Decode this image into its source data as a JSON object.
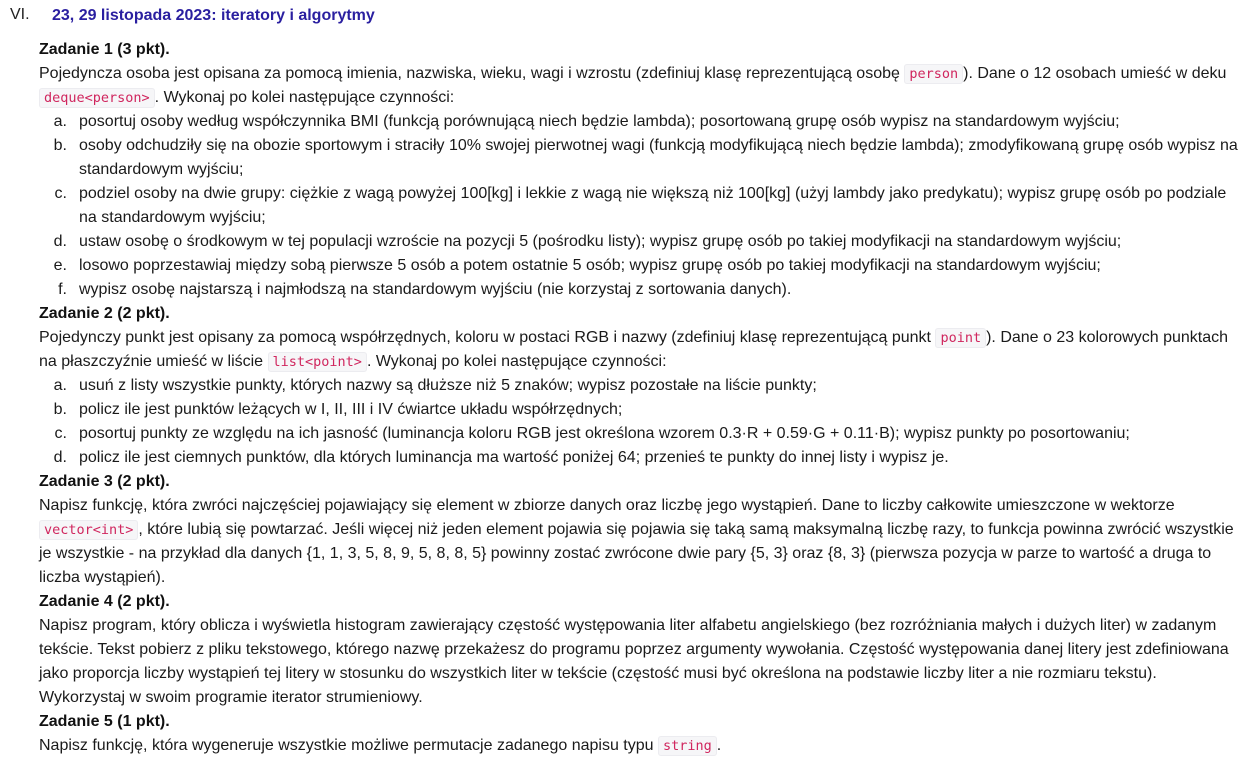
{
  "section": {
    "number": "VI.",
    "title": "23, 29 listopada 2023: iteratory i algorytmy"
  },
  "tasks": [
    {
      "title": "Zadanie 1 (3 pkt).",
      "intro": [
        "Pojedyncza osoba jest opisana za pomocą imienia, nazwiska, wieku, wagi i wzrostu (zdefiniuj klasę reprezentującą osobę ",
        "person",
        "). Dane o 12 osobach umieść w deku ",
        "deque<person>",
        ". Wykonaj po kolei następujące czynności:"
      ],
      "items": [
        [
          "a.",
          "posortuj osoby według współczynnika BMI (funkcją porównującą niech będzie lambda); posortowaną grupę osób wypisz na standardowym wyjściu;"
        ],
        [
          "b.",
          "osoby odchudziły się na obozie sportowym i straciły 10% swojej pierwotnej wagi (funkcją modyfikującą niech będzie lambda); zmodyfikowaną grupę osób wypisz na standardowym wyjściu;"
        ],
        [
          "c.",
          "podziel osoby na dwie grupy: ciężkie z wagą powyżej 100[kg] i lekkie z wagą nie większą niż 100[kg] (użyj lambdy jako predykatu); wypisz grupę osób po podziale na standardowym wyjściu;"
        ],
        [
          "d.",
          "ustaw osobę o środkowym w tej populacji wzroście na pozycji 5 (pośrodku listy); wypisz grupę osób po takiej modyfikacji na standardowym wyjściu;"
        ],
        [
          "e.",
          "losowo poprzestawiaj między sobą pierwsze 5 osób a potem ostatnie 5 osób; wypisz grupę osób po takiej modyfikacji na standardowym wyjściu;"
        ],
        [
          "f.",
          "wypisz osobę najstarszą i najmłodszą na standardowym wyjściu (nie korzystaj z sortowania danych)."
        ]
      ]
    },
    {
      "title": "Zadanie 2 (2 pkt).",
      "intro": [
        "Pojedynczy punkt jest opisany za pomocą współrzędnych, koloru w postaci RGB i nazwy (zdefiniuj klasę reprezentującą punkt ",
        "point",
        "). Dane o 23 kolorowych punktach na płaszczyźnie umieść w liście ",
        "list<point>",
        ". Wykonaj po kolei następujące czynności:"
      ],
      "items": [
        [
          "a.",
          "usuń z listy wszystkie punkty, których nazwy są dłuższe niż 5 znaków; wypisz pozostałe na liście punkty;"
        ],
        [
          "b.",
          "policz ile jest punktów leżących w I, II, III i IV ćwiartce układu współrzędnych;"
        ],
        [
          "c.",
          "posortuj punkty ze względu na ich jasność (luminancja koloru RGB jest określona wzorem 0.3·R + 0.59·G + 0.11·B); wypisz punkty po posortowaniu;"
        ],
        [
          "d.",
          "policz ile jest ciemnych punktów, dla których luminancja ma wartość poniżej 64; przenieś te punkty do innej listy i wypisz je."
        ]
      ]
    },
    {
      "title": "Zadanie 3 (2 pkt).",
      "intro": [
        "Napisz funkcję, która zwróci najczęściej pojawiający się element w zbiorze danych oraz liczbę jego wystąpień. Dane to liczby całkowite umieszczone w wektorze ",
        "vector<int>",
        ", które lubią się powtarzać. Jeśli więcej niż jeden element pojawia się pojawia się taką samą maksymalną liczbę razy, to funkcja powinna zwrócić wszystkie je wszystkie - na przykład dla danych {1, 1, 3, 5, 8, 9, 5, 8, 8, 5} powinny zostać zwrócone dwie pary {5, 3} oraz {8, 3} (pierwsza pozycja w parze to wartość a druga to liczba wystąpień)."
      ]
    },
    {
      "title": "Zadanie 4 (2 pkt).",
      "intro": [
        "Napisz program, który oblicza i wyświetla histogram zawierający częstość występowania liter alfabetu angielskiego (bez rozróżniania małych i dużych liter) w zadanym tekście. Tekst pobierz z pliku tekstowego, którego nazwę przekażesz do programu poprzez argumenty wywołania. Częstość występowania danej litery jest zdefiniowana jako proporcja liczby wystąpień tej litery w stosunku do wszystkich liter w tekście (częstość musi być określona na podstawie liczby liter a nie rozmiaru tekstu). Wykorzystaj w swoim programie iterator strumieniowy."
      ]
    },
    {
      "title": "Zadanie 5 (1 pkt).",
      "intro": [
        "Napisz funkcję, która wygeneruje wszystkie możliwe permutacje zadanego napisu typu ",
        "string",
        "."
      ]
    }
  ]
}
